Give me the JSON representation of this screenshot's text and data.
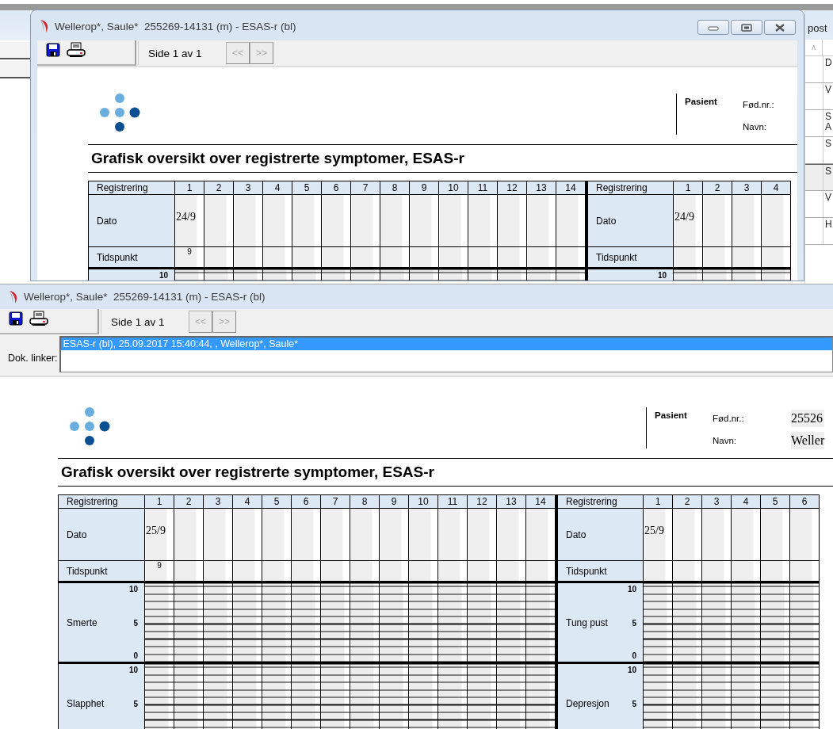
{
  "side_panel": {
    "title": "post",
    "sort_mark": "∧",
    "rows": [
      {
        "lines": [
          "D"
        ],
        "selected": false
      },
      {
        "lines": [
          "V"
        ],
        "selected": false
      },
      {
        "lines": [
          "S",
          "A"
        ],
        "selected": false
      },
      {
        "lines": [
          "S"
        ],
        "selected": false
      },
      {
        "lines": [
          "S"
        ],
        "selected": true
      },
      {
        "lines": [
          "V"
        ],
        "selected": false
      },
      {
        "lines": [
          "H"
        ],
        "selected": false
      }
    ]
  },
  "windows": [
    {
      "title": "Wellerop*, Saule*  255269-14131 (m) - ESAS-r (bl)",
      "controls": [
        {
          "kind": "minimize"
        },
        {
          "kind": "maximize"
        },
        {
          "kind": "close"
        }
      ],
      "page_label": "Side 1 av 1",
      "prev": {
        "label": "<<",
        "disabled": true
      },
      "next": {
        "label": ">>",
        "disabled": true
      },
      "document": {
        "patient": {
          "heading": "Pasient",
          "fields": [
            {
              "label": "Fød.nr.:"
            },
            {
              "label": "Navn:"
            }
          ]
        },
        "title": "Grafisk oversikt over registrerte symptomer, ESAS-r",
        "blocks": [
          {
            "header": "Registrering",
            "columns": [
              "1",
              "2",
              "3",
              "4",
              "5",
              "6",
              "7",
              "8",
              "9",
              "10",
              "11",
              "12",
              "13",
              "14"
            ],
            "rows": [
              {
                "kind": "date",
                "label": "Dato",
                "values": [
                  "24/9"
                ]
              },
              {
                "kind": "time",
                "label": "Tidspunkt",
                "values": [
                  "9"
                ]
              }
            ],
            "symptoms": [
              {
                "scale": [
                  "10"
                ]
              }
            ]
          },
          {
            "header": "Registrering",
            "columns": [
              "1",
              "2",
              "3",
              "4"
            ],
            "rows": [
              {
                "kind": "date",
                "label": "Dato",
                "values": [
                  "24/9"
                ]
              },
              {
                "kind": "time",
                "label": "Tidspunkt",
                "values": []
              }
            ],
            "symptoms": [
              {
                "scale": [
                  "10"
                ]
              }
            ]
          }
        ]
      }
    },
    {
      "title": "Wellerop*, Saule*  255269-14131 (m) - ESAS-r (bl)",
      "page_label": "Side 1 av 1",
      "prev": {
        "label": "<<",
        "disabled": true
      },
      "next": {
        "label": ">>",
        "disabled": true
      },
      "dok_linker": {
        "label": "Dok. linker:",
        "items": [
          {
            "text": "ESAS-r (bl), 25.09.2017 15:40:44, , Wellerop*, Saule*",
            "selected": true
          }
        ]
      },
      "document": {
        "patient": {
          "heading": "Pasient",
          "fields": [
            {
              "label": "Fød.nr.:",
              "value": "25526"
            },
            {
              "label": "Navn:",
              "value": "Weller"
            }
          ]
        },
        "title": "Grafisk oversikt over registrerte symptomer, ESAS-r",
        "blocks": [
          {
            "header": "Registrering",
            "columns": [
              "1",
              "2",
              "3",
              "4",
              "5",
              "6",
              "7",
              "8",
              "9",
              "10",
              "11",
              "12",
              "13",
              "14"
            ],
            "rows": [
              {
                "kind": "date",
                "label": "Dato",
                "values": [
                  "25/9"
                ]
              },
              {
                "kind": "time",
                "label": "Tidspunkt",
                "values": [
                  "9"
                ]
              }
            ],
            "symptoms": [
              {
                "name": "Smerte",
                "scale": [
                  "10",
                  "5",
                  "0"
                ]
              },
              {
                "name": "Slapphet",
                "scale": [
                  "10",
                  "5"
                ]
              }
            ]
          },
          {
            "header": "Registrering",
            "columns": [
              "1",
              "2",
              "3",
              "4",
              "5",
              "6"
            ],
            "rows": [
              {
                "kind": "date",
                "label": "Dato",
                "values": [
                  "25/9"
                ]
              },
              {
                "kind": "time",
                "label": "Tidspunkt",
                "values": []
              }
            ],
            "symptoms": [
              {
                "name": "Tung pust",
                "scale": [
                  "10",
                  "5",
                  "0"
                ]
              },
              {
                "name": "Depresjon",
                "scale": [
                  "10",
                  "5"
                ]
              }
            ]
          }
        ]
      }
    }
  ]
}
